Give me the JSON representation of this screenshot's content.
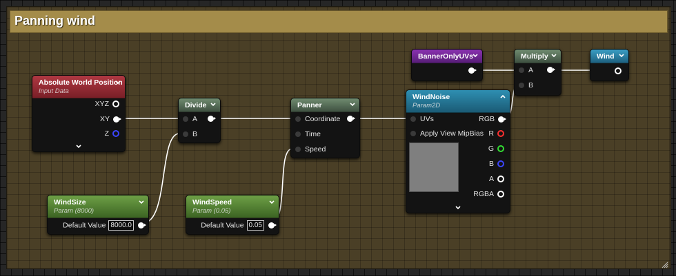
{
  "comment": {
    "title": "Panning wind"
  },
  "nodes": {
    "absolute_world_position": {
      "title": "Absolute World Position",
      "subtitle": "Input Data",
      "outputs": [
        "XYZ",
        "XY",
        "Z"
      ]
    },
    "divide": {
      "title": "Divide",
      "inputs": [
        "A",
        "B"
      ]
    },
    "panner": {
      "title": "Panner",
      "inputs": [
        "Coordinate",
        "Time",
        "Speed"
      ]
    },
    "wind_noise": {
      "title": "WindNoise",
      "subtitle": "Param2D",
      "inputs": [
        "UVs",
        "Apply View MipBias"
      ],
      "outputs": [
        "RGB",
        "R",
        "G",
        "B",
        "A",
        "RGBA"
      ]
    },
    "banner_only_uvs": {
      "title": "BannerOnlyUVs"
    },
    "multiply": {
      "title": "Multiply",
      "inputs": [
        "A",
        "B"
      ]
    },
    "wind": {
      "title": "Wind"
    },
    "wind_size": {
      "title": "WindSize",
      "subtitle": "Param (8000)",
      "label": "Default Value",
      "value": "8000.0"
    },
    "wind_speed": {
      "title": "WindSpeed",
      "subtitle": "Param (0.05)",
      "label": "Default Value",
      "value": "0.05"
    }
  },
  "colors": {
    "comment_header": "#a48c4a",
    "comment_body": "#4a3f26",
    "pin_r": "#ff3030",
    "pin_g": "#33dd33",
    "pin_b": "#3b45ff",
    "wire": "#ffffff"
  },
  "icons": {
    "collapse": "chevron-down-icon",
    "expand": "chevron-up-icon",
    "resize": "resize-grip-icon"
  }
}
